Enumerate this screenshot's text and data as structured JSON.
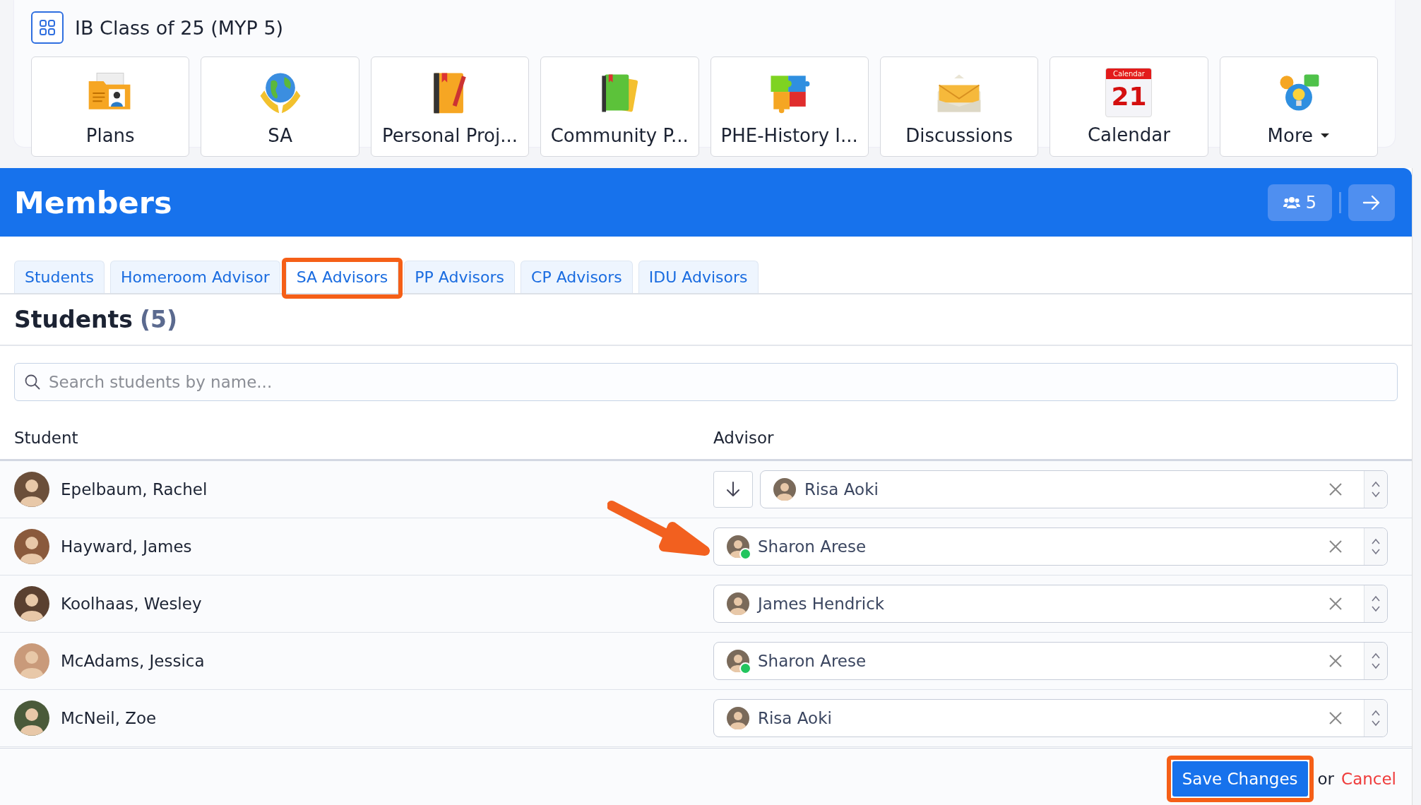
{
  "header": {
    "title": "IB Class of 25 (MYP 5)"
  },
  "tiles": [
    {
      "label": "Plans",
      "kind": "folder",
      "dropdown": false
    },
    {
      "label": "SA",
      "kind": "globe",
      "dropdown": false
    },
    {
      "label": "Personal Proj...",
      "kind": "notebook",
      "dropdown": false
    },
    {
      "label": "Community P...",
      "kind": "books",
      "dropdown": false
    },
    {
      "label": "PHE-History I...",
      "kind": "puzzle",
      "dropdown": false
    },
    {
      "label": "Discussions",
      "kind": "envelope",
      "dropdown": false
    },
    {
      "label": "Calendar",
      "kind": "calendar",
      "day": "21",
      "caption": "Calendar",
      "dropdown": false
    },
    {
      "label": "More",
      "kind": "more",
      "dropdown": true
    }
  ],
  "members": {
    "title": "Members",
    "count": "5"
  },
  "tabs": [
    {
      "label": "Students",
      "selected": false,
      "highlighted": false
    },
    {
      "label": "Homeroom Advisor",
      "selected": false,
      "highlighted": false
    },
    {
      "label": "SA Advisors",
      "selected": true,
      "highlighted": true
    },
    {
      "label": "PP Advisors",
      "selected": false,
      "highlighted": false
    },
    {
      "label": "CP Advisors",
      "selected": false,
      "highlighted": false
    },
    {
      "label": "IDU Advisors",
      "selected": false,
      "highlighted": false
    }
  ],
  "section": {
    "title": "Students",
    "count": "(5)"
  },
  "search": {
    "placeholder": "Search students by name..."
  },
  "table": {
    "columns": [
      "Student",
      "Advisor"
    ],
    "rows": [
      {
        "student": "Epelbaum, Rachel",
        "advisor": "Risa Aoki",
        "online": false,
        "copy_down": true,
        "pointed": false
      },
      {
        "student": "Hayward, James",
        "advisor": "Sharon Arese",
        "online": true,
        "copy_down": false,
        "pointed": true
      },
      {
        "student": "Koolhaas, Wesley",
        "advisor": "James Hendrick",
        "online": false,
        "copy_down": false,
        "pointed": false
      },
      {
        "student": "McAdams, Jessica",
        "advisor": "Sharon Arese",
        "online": true,
        "copy_down": false,
        "pointed": false
      },
      {
        "student": "McNeil, Zoe",
        "advisor": "Risa Aoki",
        "online": false,
        "copy_down": false,
        "pointed": false
      }
    ]
  },
  "footer": {
    "save": "Save Changes",
    "highlighted": true,
    "or": "or",
    "cancel": "Cancel"
  }
}
